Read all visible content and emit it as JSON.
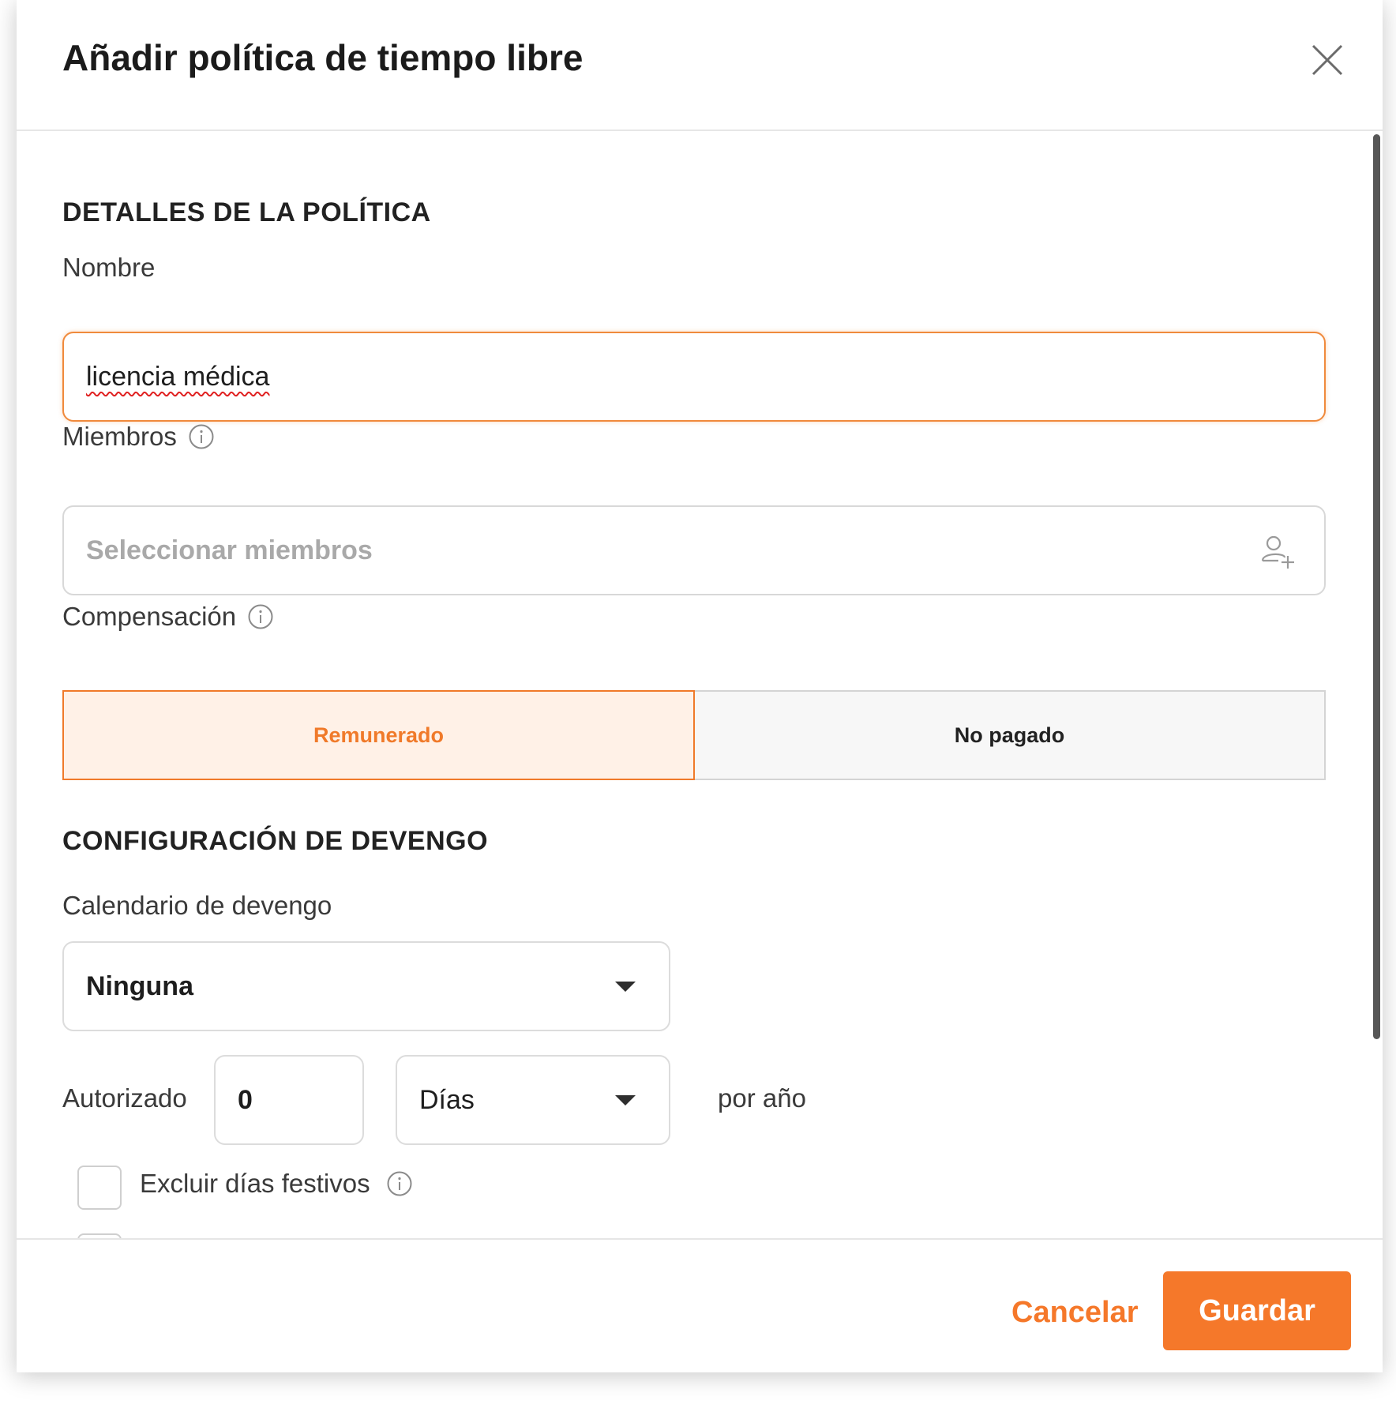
{
  "dialog": {
    "title": "Añadir política de tiempo libre"
  },
  "policy_details": {
    "section_title": "DETALLES DE LA POLÍTICA",
    "name": {
      "label": "Nombre",
      "value": "licencia médica"
    },
    "members": {
      "label": "Miembros",
      "placeholder": "Seleccionar miembros"
    },
    "compensation": {
      "label": "Compensación",
      "options": [
        "Remunerado",
        "No pagado"
      ],
      "selected": "Remunerado"
    }
  },
  "accrual": {
    "section_title": "CONFIGURACIÓN DE DEVENGO",
    "schedule": {
      "label": "Calendario de devengo",
      "value": "Ninguna"
    },
    "allowance": {
      "label": "Autorizado",
      "amount": "0",
      "unit": "Días",
      "period": "por año"
    },
    "exclude_holidays": {
      "label": "Excluir días festivos",
      "checked": false
    }
  },
  "footer": {
    "cancel_label": "Cancelar",
    "save_label": "Guardar"
  },
  "colors": {
    "accent": "#f5782a",
    "accent_light": "#fff1e7"
  }
}
